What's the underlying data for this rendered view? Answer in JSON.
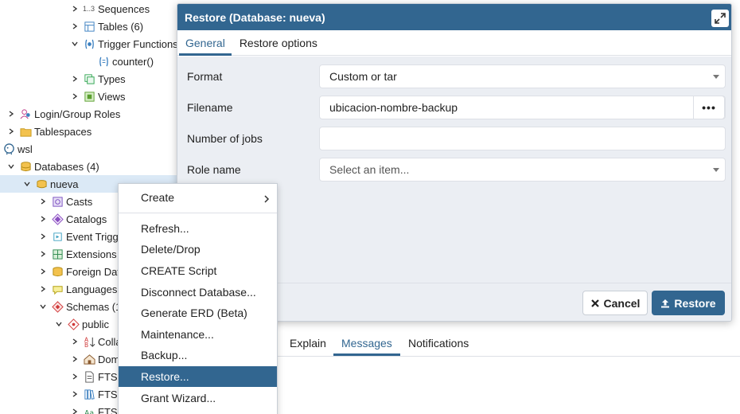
{
  "tree": {
    "sequences": "Sequences",
    "sequences_prefix": "1..3",
    "tables": "Tables (6)",
    "trigger_functions": "Trigger Functions",
    "counter": "counter()",
    "types": "Types",
    "views": "Views",
    "login_roles": "Login/Group Roles",
    "tablespaces": "Tablespaces",
    "wsl": "wsl",
    "databases": "Databases (4)",
    "nueva": "nueva",
    "casts": "Casts",
    "catalogs": "Catalogs",
    "event_triggers": "Event Trigg",
    "extensions": "Extensions",
    "foreign_data": "Foreign Dat",
    "languages": "Languages",
    "schemas": "Schemas (1",
    "public": "public",
    "collations": "Colla",
    "domains": "Dom",
    "fts1": "FTS",
    "fts2": "FTS",
    "fts3": "FTS"
  },
  "dialog": {
    "title": "Restore (Database: nueva)",
    "tabs": [
      "General",
      "Restore options"
    ],
    "format_label": "Format",
    "format_value": "Custom or tar",
    "filename_label": "Filename",
    "filename_value": "ubicacion-nombre-backup",
    "browse_label": "•••",
    "jobs_label": "Number of jobs",
    "jobs_value": "",
    "role_label": "Role name",
    "role_placeholder": "Select an item...",
    "cancel_label": "Cancel",
    "restore_label": "Restore"
  },
  "bottom_tabs": [
    "Explain",
    "Messages",
    "Notifications"
  ],
  "context_menu": {
    "create": "Create",
    "items": [
      "Refresh...",
      "Delete/Drop",
      "CREATE Script",
      "Disconnect Database...",
      "Generate ERD (Beta)",
      "Maintenance...",
      "Backup...",
      "Restore...",
      "Grant Wizard..."
    ]
  },
  "colors": {
    "accent": "#326690",
    "panel_bg": "#ebeef3",
    "border": "#dde0e6",
    "selected_row": "#dbe9f6"
  }
}
